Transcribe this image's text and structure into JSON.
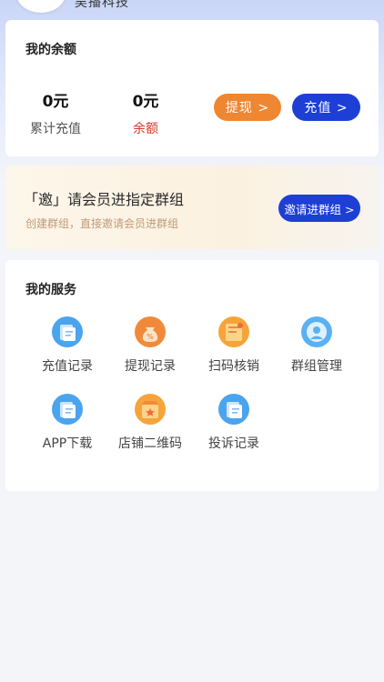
{
  "header": {
    "brand_partial": "吴播科技"
  },
  "balance": {
    "title": "我的余额",
    "total_recharge_value": "0元",
    "total_recharge_label": "累计充值",
    "balance_value": "0元",
    "balance_label": "余额",
    "withdraw_label": "提现 >",
    "recharge_label": "充值 >"
  },
  "invite": {
    "title": "「邀」请会员进指定群组",
    "subtitle": "创建群组，直接邀请会员进群组",
    "button_label": "邀请进群组 >"
  },
  "services": {
    "title": "我的服务",
    "items": [
      {
        "label": "充值记录",
        "icon": "document-icon"
      },
      {
        "label": "提现记录",
        "icon": "coin-bag-icon"
      },
      {
        "label": "扫码核销",
        "icon": "receipt-icon"
      },
      {
        "label": "群组管理",
        "icon": "user-icon"
      },
      {
        "label": "APP下载",
        "icon": "document-icon"
      },
      {
        "label": "店铺二维码",
        "icon": "shop-icon"
      },
      {
        "label": "投诉记录",
        "icon": "document-icon"
      }
    ]
  },
  "colors": {
    "primary_blue": "#1d3fd6",
    "orange": "#ee8632",
    "balance_red": "#d23a2a"
  }
}
